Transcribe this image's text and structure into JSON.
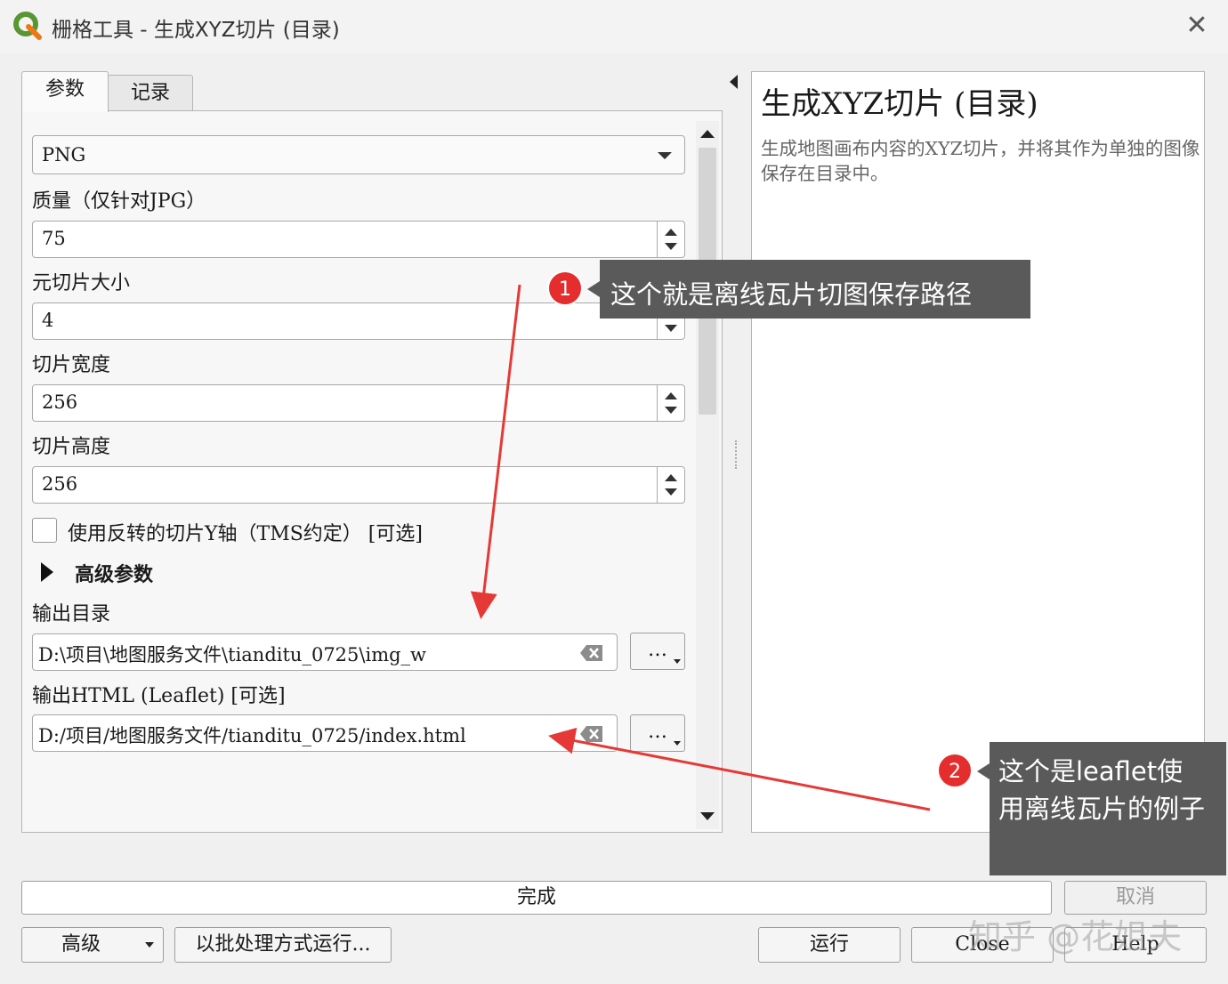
{
  "window": {
    "title": "栅格工具 - 生成XYZ切片 (目录)",
    "accent": "#589632"
  },
  "tabs": [
    {
      "label": "参数"
    },
    {
      "label": "记录"
    }
  ],
  "params": {
    "format_value": "PNG",
    "quality_label": "质量（仅针对JPG）",
    "quality_value": "75",
    "metatile_label": "元切片大小",
    "metatile_value": "4",
    "tile_width_label": "切片宽度",
    "tile_width_value": "256",
    "tile_height_label": "切片高度",
    "tile_height_value": "256",
    "tms_label": "使用反转的切片Y轴（TMS约定） [可选]",
    "advanced_label": "高级参数",
    "output_dir_label": "输出目录",
    "output_dir_value": "D:\\项目\\地图服务文件\\tianditu_0725\\img_w",
    "output_html_label": "输出HTML (Leaflet) [可选]",
    "output_html_value": "D:/项目/地图服务文件/tianditu_0725/index.html",
    "browse_label": "…"
  },
  "help": {
    "title": "生成XYZ切片 (目录)",
    "body": "生成地图画布内容的XYZ切片，并将其作为单独的图像保存在目录中。"
  },
  "progress": {
    "label": "完成",
    "cancel_label": "取消"
  },
  "bottom": {
    "advanced_label": "高级",
    "batch_label": "以批处理方式运行...",
    "run_label": "运行",
    "close_label": "Close",
    "help_label": "Help"
  },
  "annotations": [
    {
      "number": "1",
      "text": "这个就是离线瓦片切图保存路径"
    },
    {
      "number": "2",
      "text": "这个是leaflet使用离线瓦片的例子"
    }
  ],
  "watermark": "知乎 @花姐夫",
  "colors": {
    "callout_bg": "#5a5a5a",
    "badge": "#e52d2d",
    "arrow": "#e53935"
  }
}
